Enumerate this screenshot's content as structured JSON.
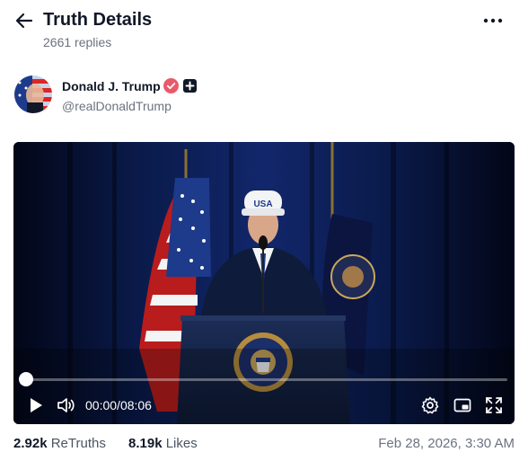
{
  "header": {
    "title": "Truth Details",
    "replies": "2661 replies"
  },
  "author": {
    "name": "Donald J. Trump",
    "handle": "@realDonaldTrump"
  },
  "video": {
    "current_time": "00:00",
    "separator": "/",
    "duration": "08:06",
    "progress": 0.0,
    "cap_text": "USA"
  },
  "stats": {
    "retruths_count": "2.92k",
    "retruths_label": "ReTruths",
    "likes_count": "8.19k",
    "likes_label": "Likes",
    "date": "Feb 28, 2026, 3:30 AM"
  },
  "colors": {
    "verified": "#e85a6a",
    "text_primary": "#111827",
    "text_secondary": "#6b7280",
    "video_bg": "#050b22"
  },
  "icons": {
    "back": "arrow-left-icon",
    "more": "more-horizontal-icon",
    "verified": "verified-badge-icon",
    "plus": "plus-badge-icon",
    "play": "play-icon",
    "volume": "volume-icon",
    "settings": "gear-icon",
    "pip": "picture-in-picture-icon",
    "fullscreen": "fullscreen-icon"
  }
}
